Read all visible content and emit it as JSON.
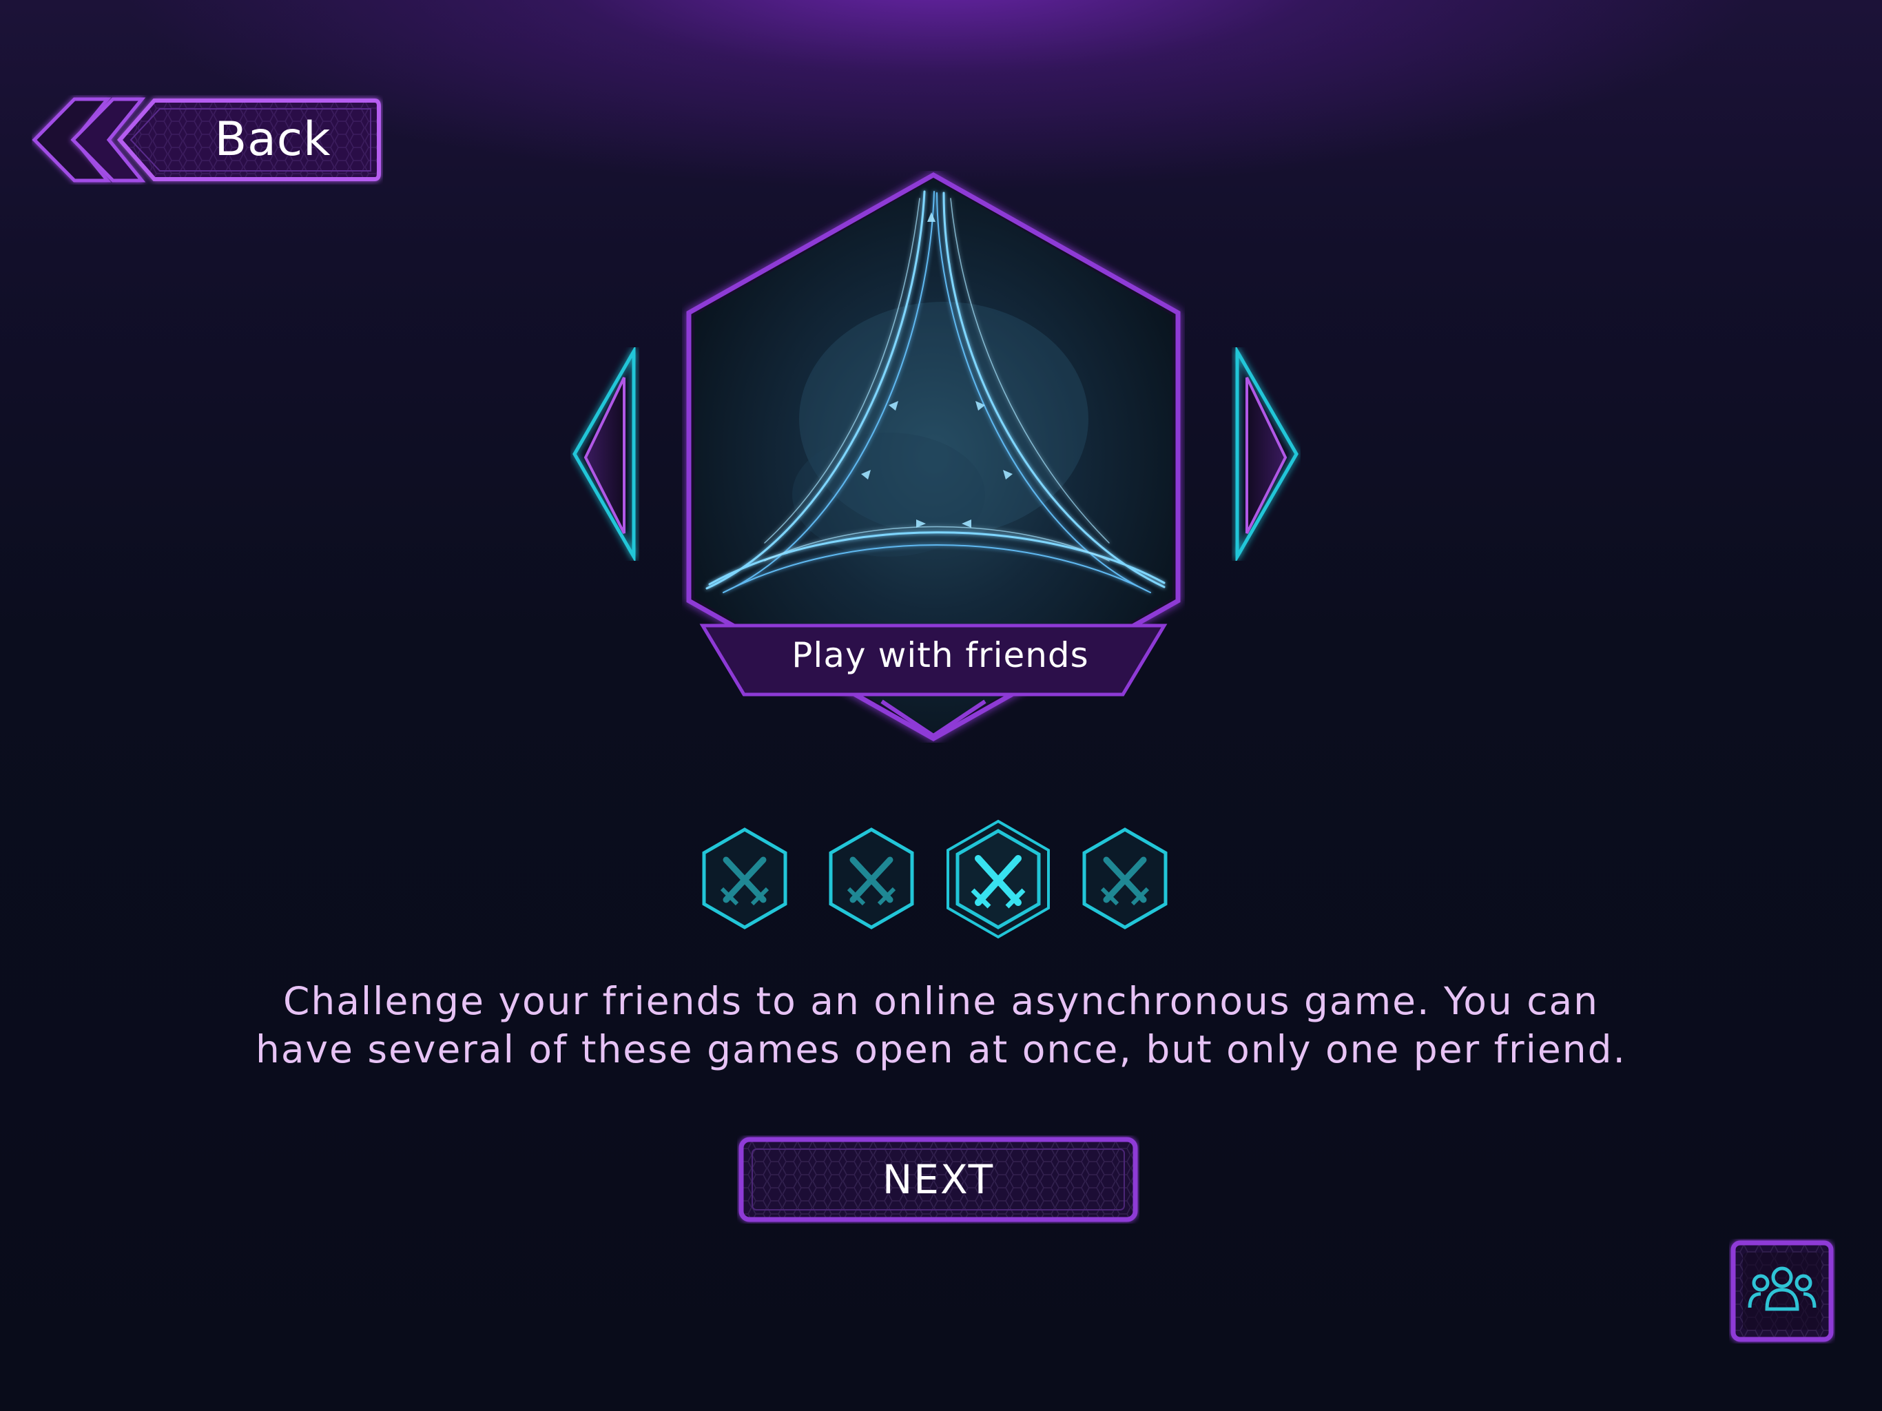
{
  "header": {
    "back_label": "Back"
  },
  "mode_carousel": {
    "current_mode_title": "Play with friends",
    "mode_count": 4,
    "selected_index": 2
  },
  "description": {
    "line1": "Challenge your friends to an online asynchronous game. You can",
    "line2": "have several of these games open at once, but only one per friend."
  },
  "actions": {
    "next_label": "NEXT"
  },
  "icons": {
    "back": "double-chevron-left-icon",
    "prev_mode": "triangle-left-icon",
    "next_mode": "triangle-right-icon",
    "mode_dot": "crossed-swords-icon",
    "friends": "group-people-icon"
  },
  "colors": {
    "accent_purple": "#9a3fe0",
    "accent_cyan": "#22c6d8",
    "text_pink": "#e7c3f5",
    "background": "#0a0d1c"
  }
}
